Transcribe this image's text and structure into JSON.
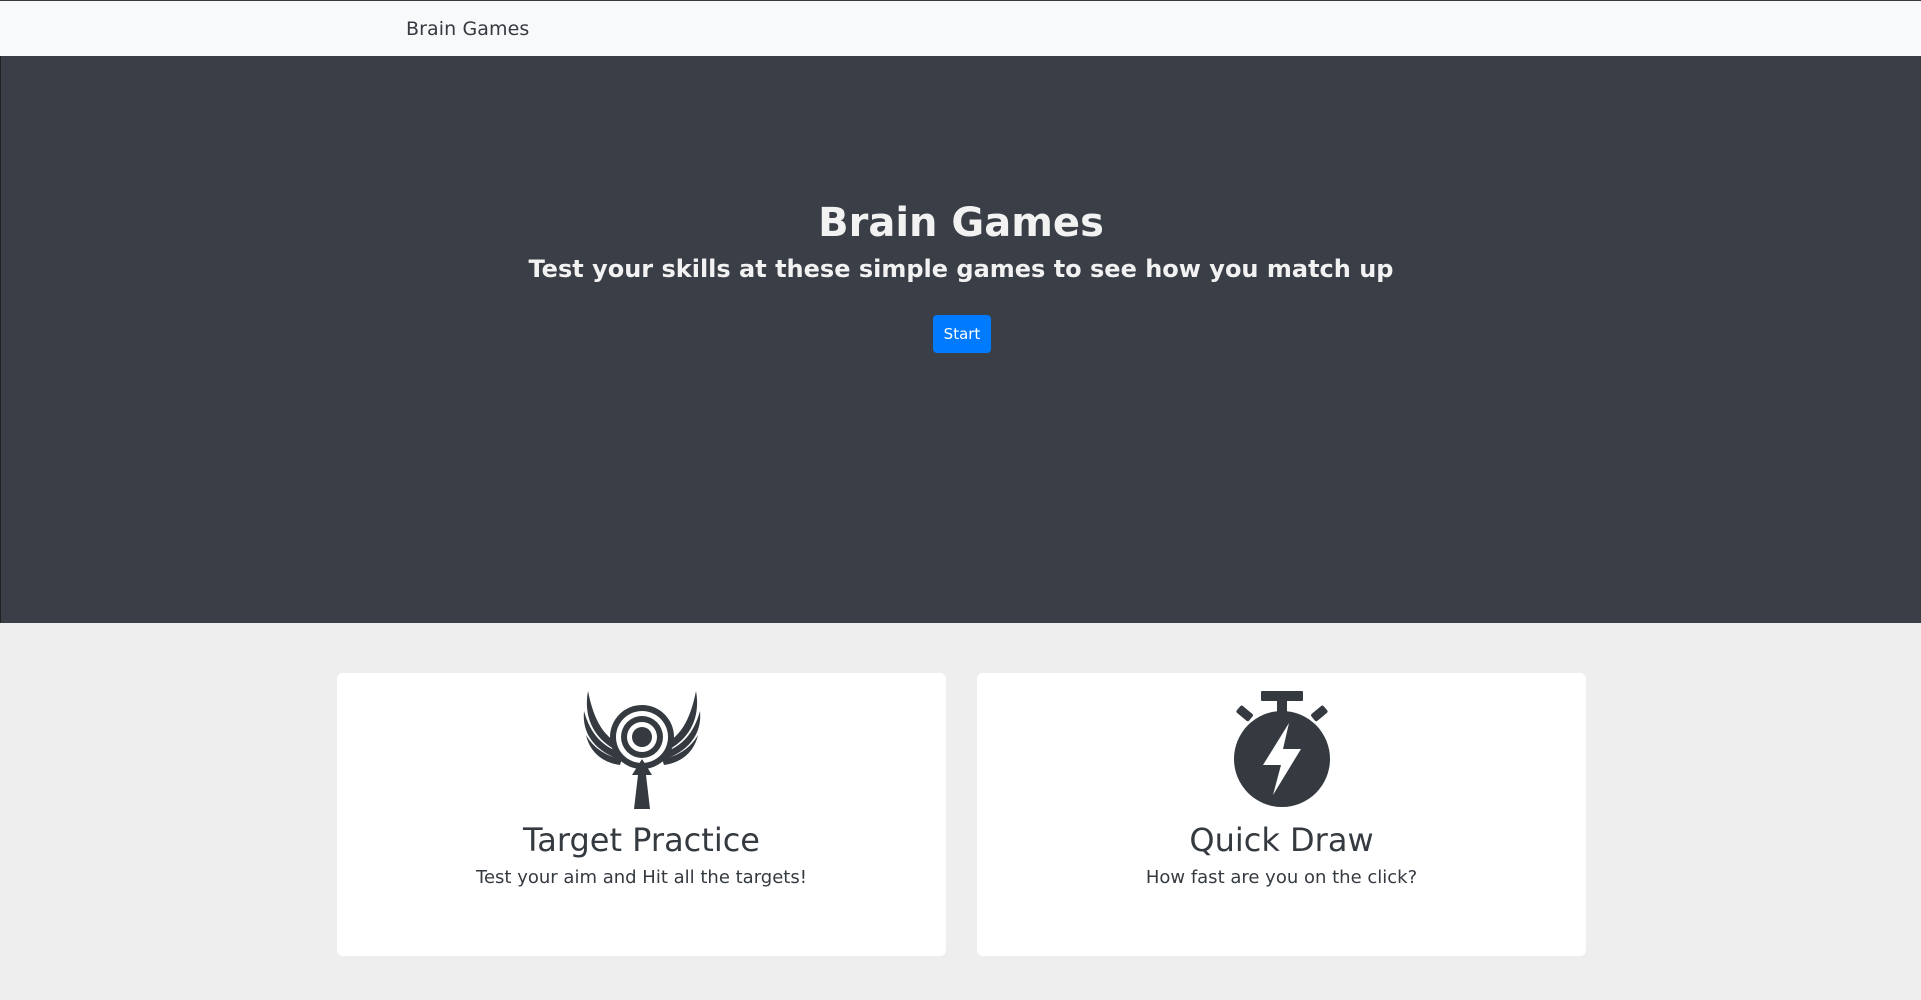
{
  "navbar": {
    "brand": "Brain Games"
  },
  "hero": {
    "title": "Brain Games",
    "subtitle": "Test your skills at these simple games to see how you match up",
    "start_label": "Start",
    "button_color": "#007bff",
    "background_color": "#3a3e47"
  },
  "games": [
    {
      "icon": "winged-target-icon",
      "title": "Target Practice",
      "description": "Test your aim and Hit all the targets!"
    },
    {
      "icon": "stopwatch-lightning-icon",
      "title": "Quick Draw",
      "description": "How fast are you on the click?"
    }
  ]
}
